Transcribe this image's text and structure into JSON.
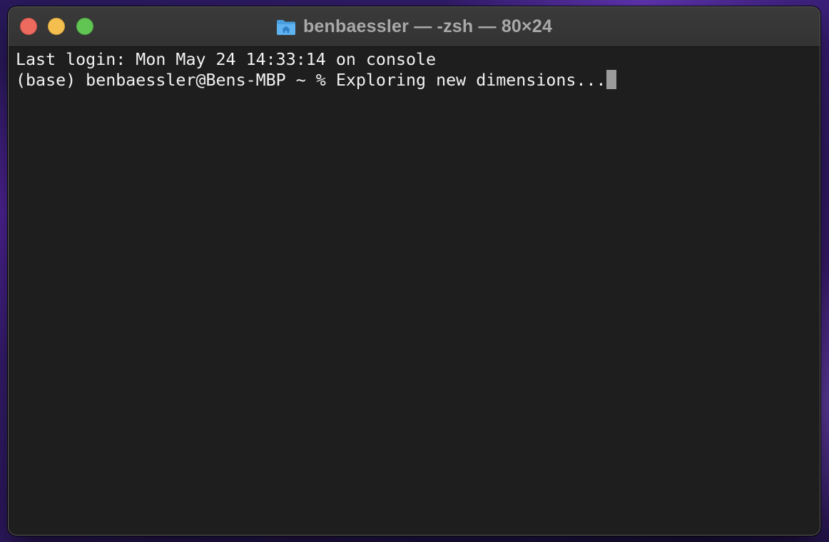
{
  "window": {
    "title": "benbaessler — -zsh — 80×24",
    "folder_icon": "home-folder-icon",
    "traffic_lights": {
      "close_color": "#ec6a5e",
      "minimize_color": "#f4bf4f",
      "zoom_color": "#61c554"
    }
  },
  "terminal": {
    "lines": [
      "Last login: Mon May 24 14:33:14 on console",
      "(base) benbaessler@Bens-MBP ~ % Exploring new dimensions..."
    ],
    "background": "#1e1e1e",
    "foreground": "#f2f2f2"
  }
}
